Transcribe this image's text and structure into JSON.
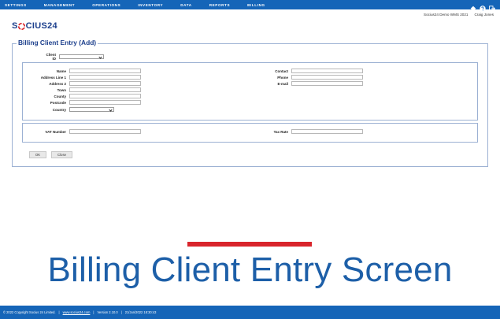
{
  "nav": {
    "items": [
      "SETTINGS",
      "MANAGEMENT",
      "OPERATIONS",
      "INVENTORY",
      "DATA",
      "REPORTS",
      "BILLING"
    ]
  },
  "userbar": {
    "environment": "Socius24 Demo WMS 2021",
    "user": "Craig Jones"
  },
  "logo": {
    "left": "S",
    "right": "CIUS24"
  },
  "form": {
    "title": "Billing Client Entry (Add)",
    "client_id_label": "Client ID",
    "left_fields": [
      {
        "label": "Name",
        "value": ""
      },
      {
        "label": "Address Line 1",
        "value": ""
      },
      {
        "label": "Address 2",
        "value": ""
      },
      {
        "label": "Town",
        "value": ""
      },
      {
        "label": "County",
        "value": ""
      },
      {
        "label": "Postcode",
        "value": ""
      }
    ],
    "country_label": "Country",
    "right_fields": [
      {
        "label": "Contact",
        "value": ""
      },
      {
        "label": "Phone",
        "value": ""
      },
      {
        "label": "E-mail",
        "value": ""
      }
    ],
    "vat_label": "VAT Number",
    "tax_label": "Tax Rate",
    "ok_label": "OK",
    "close_label": "Close"
  },
  "caption": {
    "text": "Billing Client Entry Screen"
  },
  "footer": {
    "copyright": "© 2022 Copyright Socius 24 Limited.",
    "sep": "|",
    "website": "www.socius24.com",
    "version": "Version 2.10.0",
    "date": "21/Jun/2022 18:30:43"
  },
  "colors": {
    "nav_bg": "#1565b8",
    "brand": "#1c3f8c",
    "accent_red": "#d9252c",
    "caption": "#1d5fa8"
  }
}
